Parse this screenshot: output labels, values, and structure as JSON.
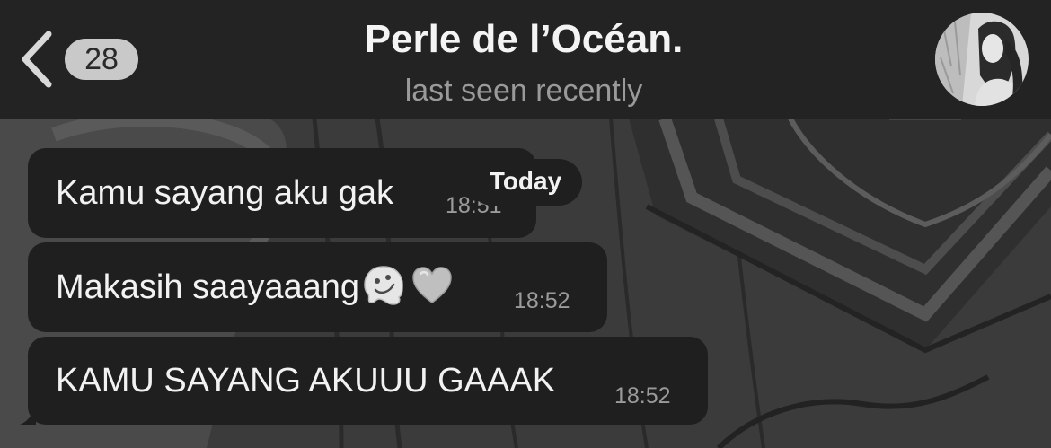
{
  "header": {
    "back_label": "Back",
    "unread_count": "28",
    "title": "Perle de l’Océan.",
    "status": "last seen recently",
    "avatar_icon": "profile-photo"
  },
  "date_separator": "Today",
  "messages": [
    {
      "text": "Kamu sayang aku gak",
      "time": "18:51"
    },
    {
      "text": "Makasih saayaaang",
      "emojis": [
        "melting-face-emoji",
        "white-heart-emoji"
      ],
      "time": "18:52"
    },
    {
      "text": "KAMU SAYANG AKUUU GAAAK",
      "time": "18:52"
    }
  ],
  "colors": {
    "header_bg": "#232323",
    "bubble_bg": "#1f1f1f",
    "badge_bg": "#c9c9c9",
    "wallpaper": "#3a3a3a"
  }
}
